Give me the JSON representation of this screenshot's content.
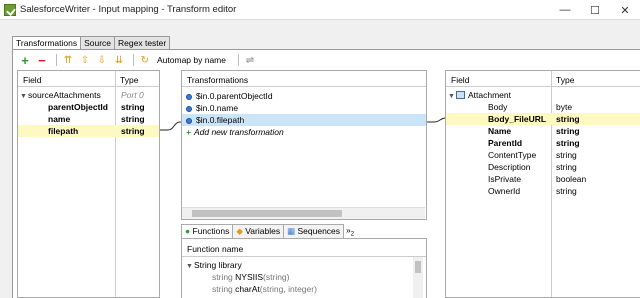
{
  "window": {
    "title": "SalesforceWriter - Input mapping - Transform editor",
    "minimize": "—",
    "maximize": "☐",
    "close": "✕"
  },
  "tabs": [
    "Transformations",
    "Source",
    "Regex tester"
  ],
  "toolbar": {
    "automap_label": "Automap by name"
  },
  "source": {
    "col_field": "Field",
    "col_type": "Type",
    "root": {
      "name": "sourceAttachments",
      "type": "Port 0"
    },
    "fields": [
      {
        "name": "parentObjectId",
        "type": "string"
      },
      {
        "name": "name",
        "type": "string"
      },
      {
        "name": "filepath",
        "type": "string"
      }
    ]
  },
  "transformations": {
    "header": "Transformations",
    "items": [
      "$in.0.parentObjectId",
      "$in.0.name",
      "$in.0.filepath"
    ],
    "add_label": "Add new transformation"
  },
  "target": {
    "col_field": "Field",
    "col_type": "Type",
    "root": {
      "name": "Attachment"
    },
    "fields": [
      {
        "name": "Body",
        "type": "byte"
      },
      {
        "name": "Body_FileURL",
        "type": "string"
      },
      {
        "name": "Name",
        "type": "string"
      },
      {
        "name": "ParentId",
        "type": "string"
      },
      {
        "name": "ContentType",
        "type": "string"
      },
      {
        "name": "Description",
        "type": "string"
      },
      {
        "name": "IsPrivate",
        "type": "boolean"
      },
      {
        "name": "OwnerId",
        "type": "string"
      }
    ]
  },
  "bottom_tabs": {
    "functions": "Functions",
    "variables": "Variables",
    "sequences": "Sequences",
    "more": "»",
    "more_count": "2"
  },
  "functions": {
    "header": "Function name",
    "group": "String library",
    "items": [
      {
        "prefix": "string",
        "name": "NYSIIS",
        "args": "(string)"
      },
      {
        "prefix": "string",
        "name": "charAt",
        "args": "(string, integer)"
      }
    ]
  },
  "colors": {
    "selected_row": "#fef9c3",
    "highlight_row": "#cce4f7",
    "accent_green": "#2e9b2e",
    "accent_orange": "#e39a16"
  }
}
